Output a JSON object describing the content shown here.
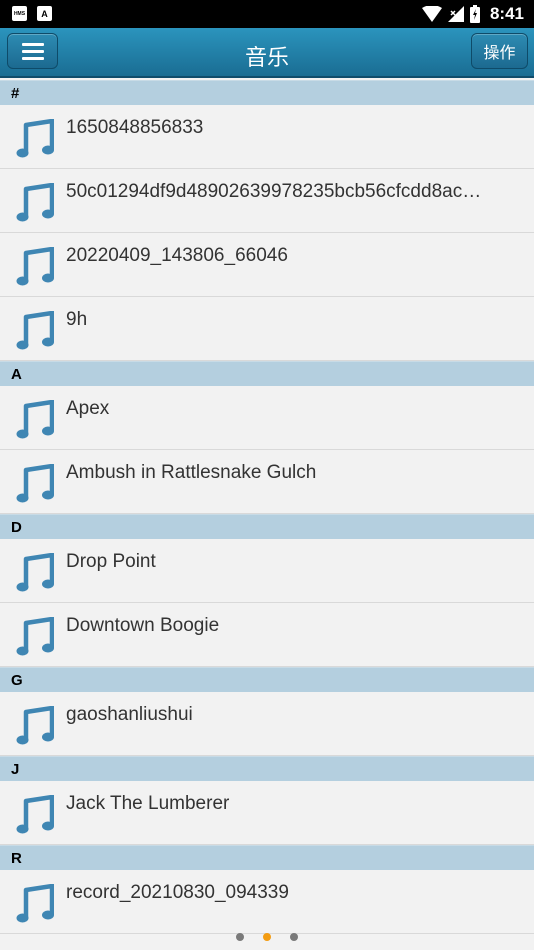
{
  "status_bar": {
    "time": "8:41",
    "left_icons": [
      "HMS",
      "A"
    ]
  },
  "header": {
    "title": "音乐",
    "action_label": "操作"
  },
  "sections": [
    {
      "letter": "#",
      "items": [
        "1650848856833",
        "50c01294df9d48902639978235bcb56cfcdd8ac…",
        "20220409_143806_66046",
        "9h"
      ]
    },
    {
      "letter": "A",
      "items": [
        "Apex",
        "Ambush in Rattlesnake Gulch"
      ]
    },
    {
      "letter": "D",
      "items": [
        "Drop Point",
        "Downtown Boogie"
      ]
    },
    {
      "letter": "G",
      "items": [
        "gaoshanliushui"
      ]
    },
    {
      "letter": "J",
      "items": [
        "Jack The Lumberer"
      ]
    },
    {
      "letter": "R",
      "items": [
        "record_20210830_094339"
      ]
    }
  ],
  "pager": {
    "count": 3,
    "active_index": 1
  },
  "colors": {
    "app_bar": "#1f7aa3",
    "section_header": "#b4cfdf",
    "note_icon": "#3f86b3",
    "active_dot": "#f39c12"
  }
}
